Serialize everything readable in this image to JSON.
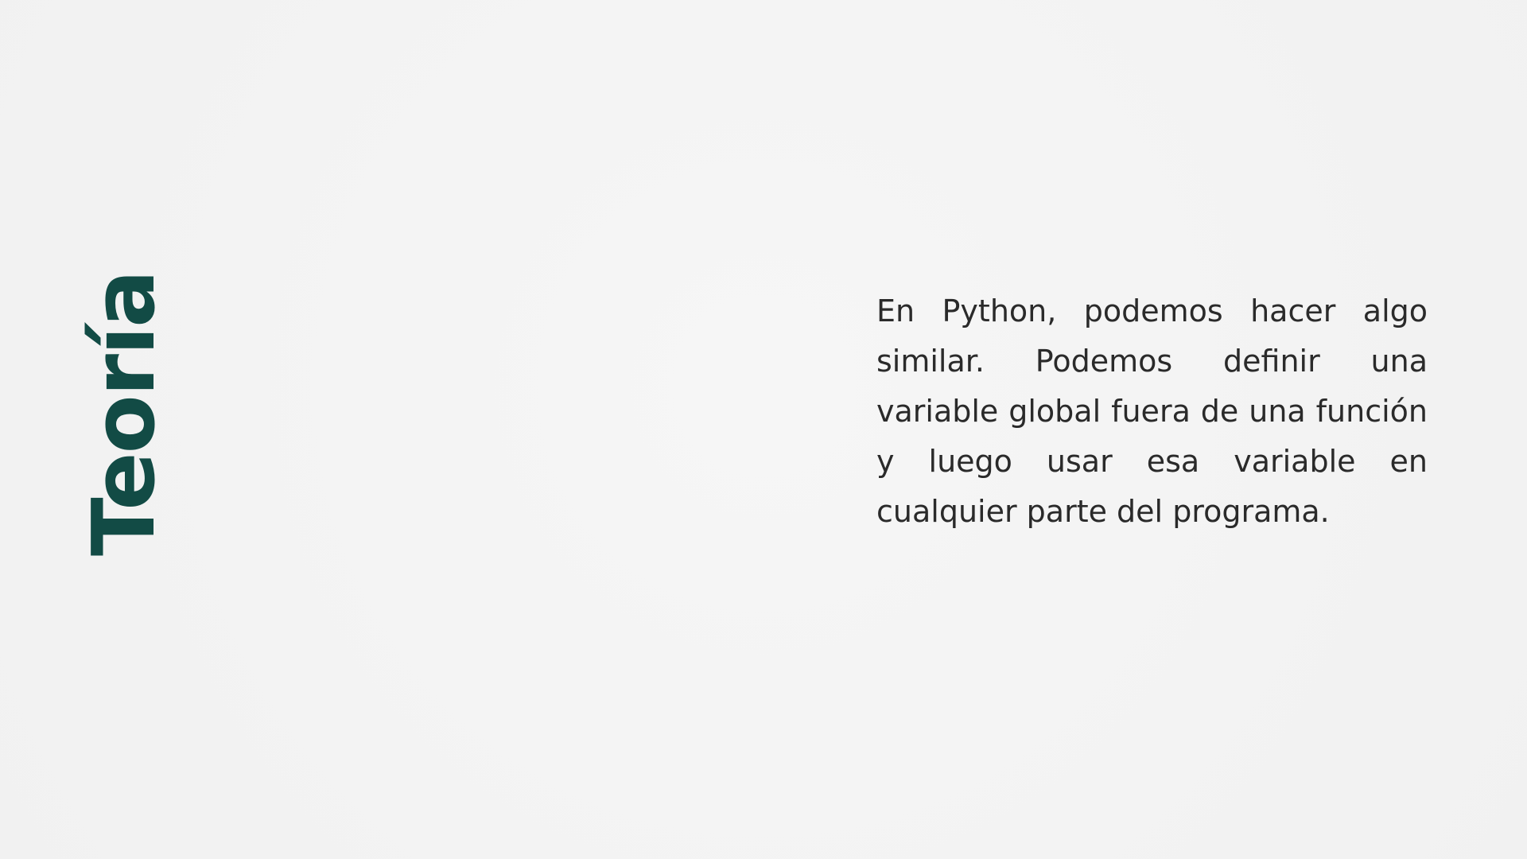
{
  "slide": {
    "title": "Teoría",
    "paragraph": "En Python, podemos hacer algo similar. Podemos definir una variable global fuera de una función y luego usar esa variable en cualquier parte del programa."
  },
  "colors": {
    "background": "#f4f4f4",
    "title": "#124b45",
    "text": "#2a2a2a"
  }
}
